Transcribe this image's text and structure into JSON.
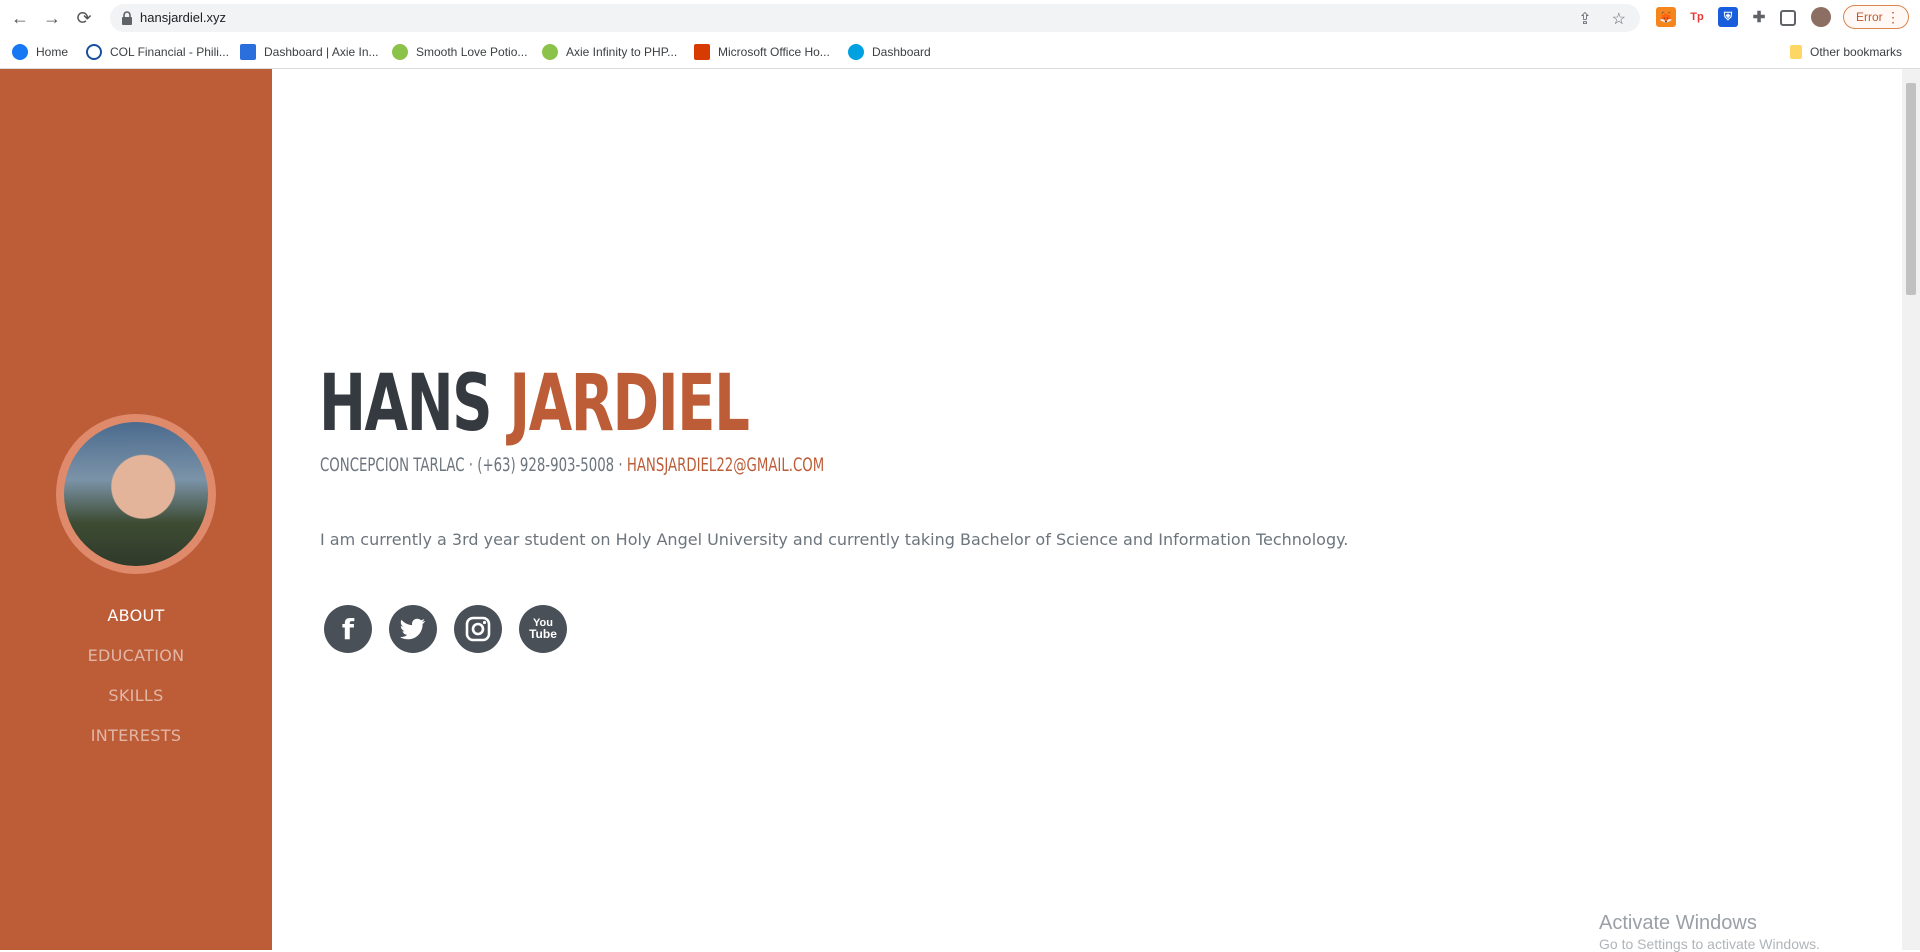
{
  "browser": {
    "url": "hansjardiel.xyz",
    "error_label": "Error",
    "bookmarks": [
      {
        "label": "Home"
      },
      {
        "label": "COL Financial - Phili..."
      },
      {
        "label": "Dashboard | Axie In..."
      },
      {
        "label": "Smooth Love Potio..."
      },
      {
        "label": "Axie Infinity to PHP..."
      },
      {
        "label": "Microsoft Office Ho..."
      },
      {
        "label": "Dashboard"
      }
    ],
    "other_bookmarks": "Other bookmarks"
  },
  "sidebar": {
    "nav": [
      {
        "label": "ABOUT"
      },
      {
        "label": "EDUCATION"
      },
      {
        "label": "SKILLS"
      },
      {
        "label": "INTERESTS"
      }
    ],
    "accent": "#bd5d38"
  },
  "main": {
    "first_name": "HANS",
    "last_name": "JARDIEL",
    "address": "CONCEPCION TARLAC · (+63) 928-903-5008 · ",
    "email": "HANSJARDIEL22@GMAIL.COM",
    "lead": "I am currently a 3rd year student on Holy Angel University and currently taking Bachelor of Science and Information Technology.",
    "social": [
      {
        "icon": "facebook-icon",
        "glyph": "f"
      },
      {
        "icon": "twitter-icon",
        "glyph": "t"
      },
      {
        "icon": "instagram-icon",
        "glyph": "◎"
      },
      {
        "icon": "youtube-icon",
        "glyph": "You Tube"
      }
    ]
  },
  "watermark": {
    "line1": "Activate Windows",
    "line2": "Go to Settings to activate Windows."
  }
}
